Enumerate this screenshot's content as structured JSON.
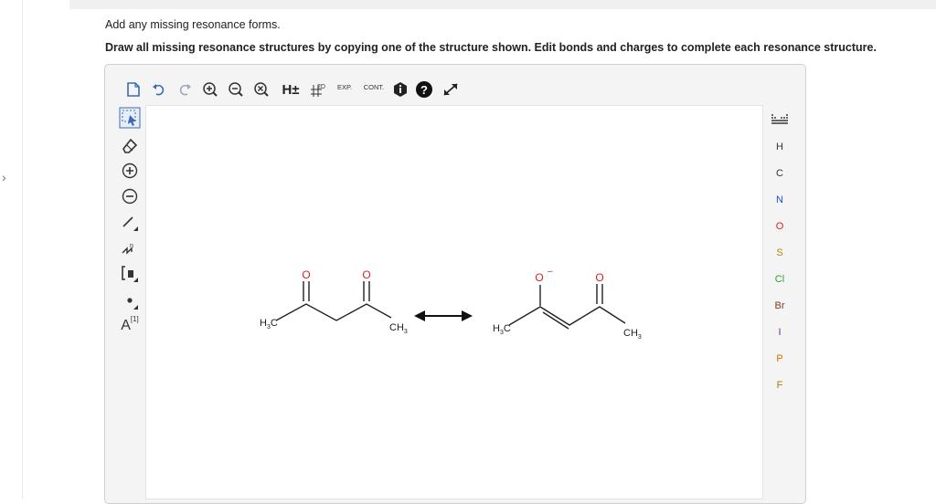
{
  "instructions": {
    "line1": "Add any missing resonance forms.",
    "line2": "Draw all missing resonance structures by copying one of the structure shown. Edit bonds and charges to complete each resonance structure."
  },
  "toolbar": {
    "h_toggle": "H±",
    "clean2d": "2D",
    "expand": "EXP.",
    "contract": "CONT."
  },
  "left_tools": {
    "bracket_text": "[ ]",
    "atom_label": "A",
    "atom_index": "[1]"
  },
  "elements": {
    "items": [
      {
        "symbol": "H",
        "color": "#333333"
      },
      {
        "symbol": "C",
        "color": "#333333"
      },
      {
        "symbol": "N",
        "color": "#1f4fd8"
      },
      {
        "symbol": "O",
        "color": "#e02020"
      },
      {
        "symbol": "S",
        "color": "#b08a00"
      },
      {
        "symbol": "Cl",
        "color": "#2e9e2e"
      },
      {
        "symbol": "Br",
        "color": "#7a3b1a"
      },
      {
        "symbol": "I",
        "color": "#7a2aa0"
      },
      {
        "symbol": "P",
        "color": "#d07000"
      },
      {
        "symbol": "F",
        "color": "#b07a00"
      }
    ]
  },
  "molecules": {
    "left": {
      "o1": "O",
      "o2": "O",
      "methyl_left_main": "H",
      "methyl_left_sub": "3",
      "methyl_left_c": "C",
      "methyl_right_c": "CH",
      "methyl_right_sub": "3"
    },
    "right": {
      "o1": "O",
      "o1_charge": "–",
      "o2": "O",
      "methyl_left_main": "H",
      "methyl_left_sub": "3",
      "methyl_left_c": "C",
      "methyl_right_c": "CH",
      "methyl_right_sub": "3"
    }
  },
  "colors": {
    "oxygen": "#e02020",
    "bond": "#222222",
    "accent": "#3b6bb5"
  }
}
